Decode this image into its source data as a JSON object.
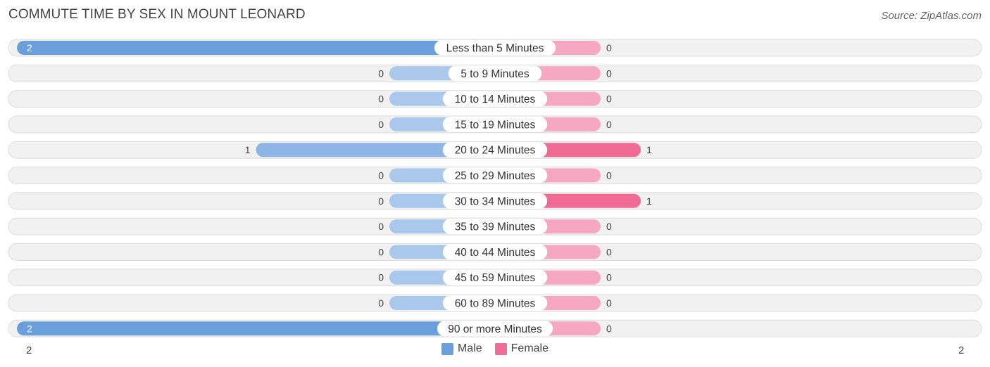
{
  "header": {
    "title": "Commute Time by Sex in Mount Leonard",
    "source": "Source: ZipAtlas.com"
  },
  "colors": {
    "male_strong": "#6a9fdc",
    "male_light": "#a9c8ec",
    "female_strong": "#f06b96",
    "female_light": "#f6a8c2",
    "row_bg": "#f1f1f1",
    "row_border": "#dddddd"
  },
  "chart_data": {
    "type": "bar",
    "orientation": "horizontal-diverging",
    "title": "Commute Time by Sex in Mount Leonard",
    "categories": [
      "Less than 5 Minutes",
      "5 to 9 Minutes",
      "10 to 14 Minutes",
      "15 to 19 Minutes",
      "20 to 24 Minutes",
      "25 to 29 Minutes",
      "30 to 34 Minutes",
      "35 to 39 Minutes",
      "40 to 44 Minutes",
      "45 to 59 Minutes",
      "60 to 89 Minutes",
      "90 or more Minutes"
    ],
    "series": [
      {
        "name": "Male",
        "values": [
          2,
          0,
          0,
          0,
          1,
          0,
          0,
          0,
          0,
          0,
          0,
          2
        ]
      },
      {
        "name": "Female",
        "values": [
          0,
          0,
          0,
          0,
          1,
          0,
          1,
          0,
          0,
          0,
          0,
          0
        ]
      }
    ],
    "xlim": [
      -2,
      2
    ],
    "axis_left_label": "2",
    "axis_right_label": "2",
    "legend": [
      "Male",
      "Female"
    ],
    "legend_position": "bottom-center",
    "grid": false
  }
}
